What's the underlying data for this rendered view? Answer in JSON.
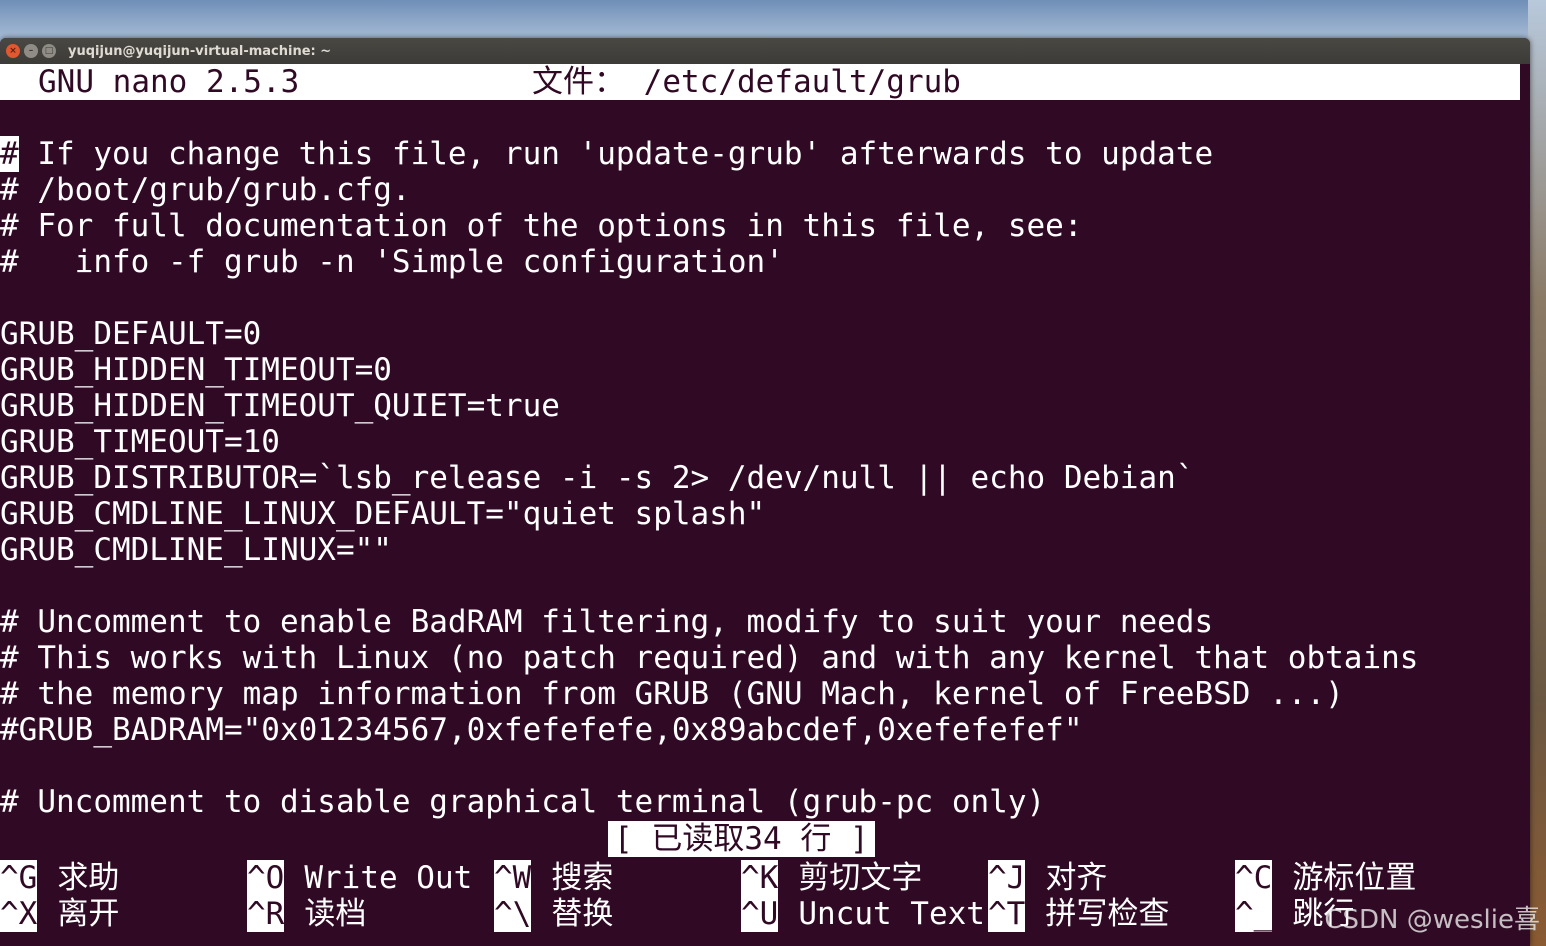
{
  "window": {
    "title": "yuqijun@yuqijun-virtual-machine: ~"
  },
  "nano": {
    "program": "GNU nano 2.5.3",
    "file_label": "文件： /etc/default/grub",
    "lines": [
      "",
      "# If you change this file, run 'update-grub' afterwards to update",
      "# /boot/grub/grub.cfg.",
      "# For full documentation of the options in this file, see:",
      "#   info -f grub -n 'Simple configuration'",
      "",
      "GRUB_DEFAULT=0",
      "GRUB_HIDDEN_TIMEOUT=0",
      "GRUB_HIDDEN_TIMEOUT_QUIET=true",
      "GRUB_TIMEOUT=10",
      "GRUB_DISTRIBUTOR=`lsb_release -i -s 2> /dev/null || echo Debian`",
      "GRUB_CMDLINE_LINUX_DEFAULT=\"quiet splash\"",
      "GRUB_CMDLINE_LINUX=\"\"",
      "",
      "# Uncomment to enable BadRAM filtering, modify to suit your needs",
      "# This works with Linux (no patch required) and with any kernel that obtains",
      "# the memory map information from GRUB (GNU Mach, kernel of FreeBSD ...)",
      "#GRUB_BADRAM=\"0x01234567,0xfefefefe,0x89abcdef,0xefefefef\"",
      "",
      "# Uncomment to disable graphical terminal (grub-pc only)"
    ],
    "cursor_char": "#",
    "first_line_rest": " If you change this file, run 'update-grub' afterwards to update",
    "status": "[ 已读取34 行 ]",
    "shortcuts": {
      "row1": [
        {
          "key": "^G",
          "label": "求助"
        },
        {
          "key": "^O",
          "label": "Write Out"
        },
        {
          "key": "^W",
          "label": "搜索"
        },
        {
          "key": "^K",
          "label": "剪切文字"
        },
        {
          "key": "^J",
          "label": "对齐"
        },
        {
          "key": "^C",
          "label": "游标位置"
        }
      ],
      "row2": [
        {
          "key": "^X",
          "label": "离开"
        },
        {
          "key": "^R",
          "label": "读档"
        },
        {
          "key": "^\\",
          "label": "替换"
        },
        {
          "key": "^U",
          "label": "Uncut Text"
        },
        {
          "key": "^T",
          "label": "拼写检查"
        },
        {
          "key": "^_",
          "label": "跳行"
        }
      ]
    }
  },
  "watermark": "CSDN @weslie喜",
  "colors": {
    "terminal_bg": "#300a24",
    "terminal_fg": "#ffffff",
    "close_button": "#e0582f"
  }
}
